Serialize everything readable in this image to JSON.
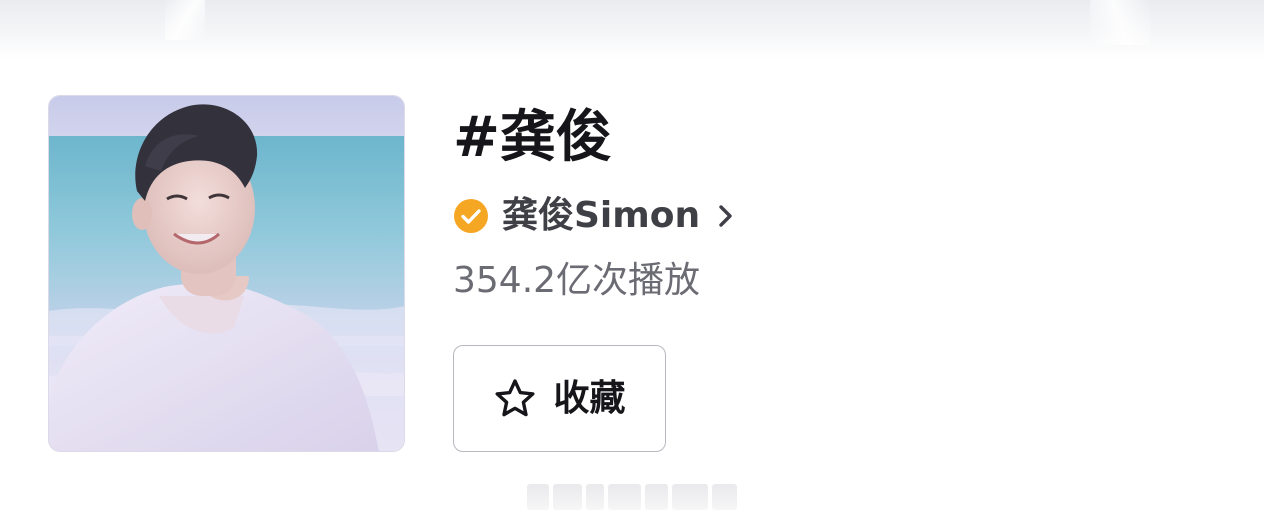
{
  "topic": {
    "title": "#龚俊",
    "creator_name": "龚俊Simon",
    "play_count": "354.2亿次播放"
  },
  "actions": {
    "favorite_label": "收藏"
  },
  "icons": {
    "verified": "verified-check-icon",
    "chevron": "chevron-right-icon",
    "star": "star-outline-icon"
  },
  "colors": {
    "verified_badge": "#f5a623",
    "title_text": "#16161a",
    "secondary_text": "#6b6b73",
    "button_border": "#b8b8bf"
  }
}
